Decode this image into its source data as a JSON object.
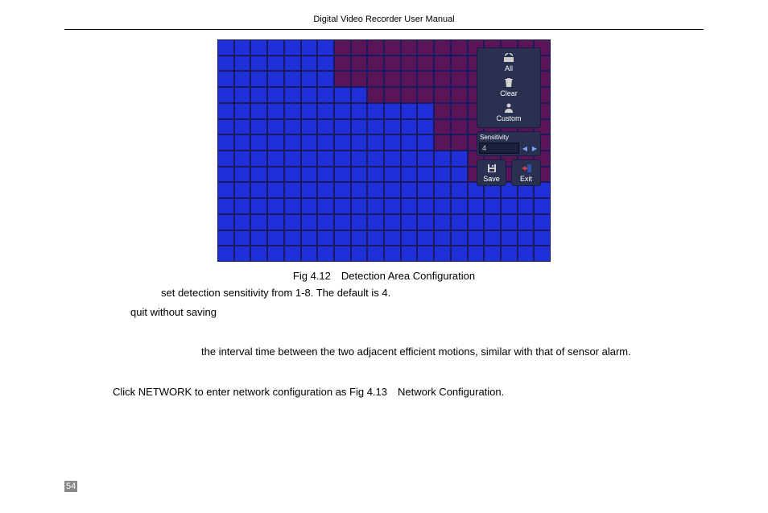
{
  "header": {
    "title": "Digital Video Recorder User Manual"
  },
  "screenshot": {
    "panel": {
      "all": "All",
      "clear": "Clear",
      "custom": "Custom",
      "sensitivity_label": "Sensitivity",
      "sensitivity_value": "4",
      "save": "Save",
      "exit": "Exit"
    },
    "grid": {
      "cols": 20,
      "rows": 14,
      "blue_regions": [
        {
          "r0": 0,
          "r1": 13,
          "c0": 0,
          "c1": 6
        },
        {
          "r0": 3,
          "r1": 13,
          "c0": 7,
          "c1": 8
        },
        {
          "r0": 4,
          "r1": 13,
          "c0": 9,
          "c1": 12
        },
        {
          "r0": 7,
          "r1": 13,
          "c0": 13,
          "c1": 14
        },
        {
          "r0": 9,
          "r1": 13,
          "c0": 15,
          "c1": 19
        }
      ]
    }
  },
  "caption": "Fig 4.12 Detection Area Configuration",
  "text": {
    "line1": "set detection sensitivity from 1-8. The default is 4.",
    "line2": "quit without saving",
    "line3": "the interval time between the two adjacent efficient motions, similar with that of sensor alarm.",
    "line4": "Click NETWORK to enter network configuration as Fig 4.13 Network Configuration."
  },
  "page_number": "54"
}
